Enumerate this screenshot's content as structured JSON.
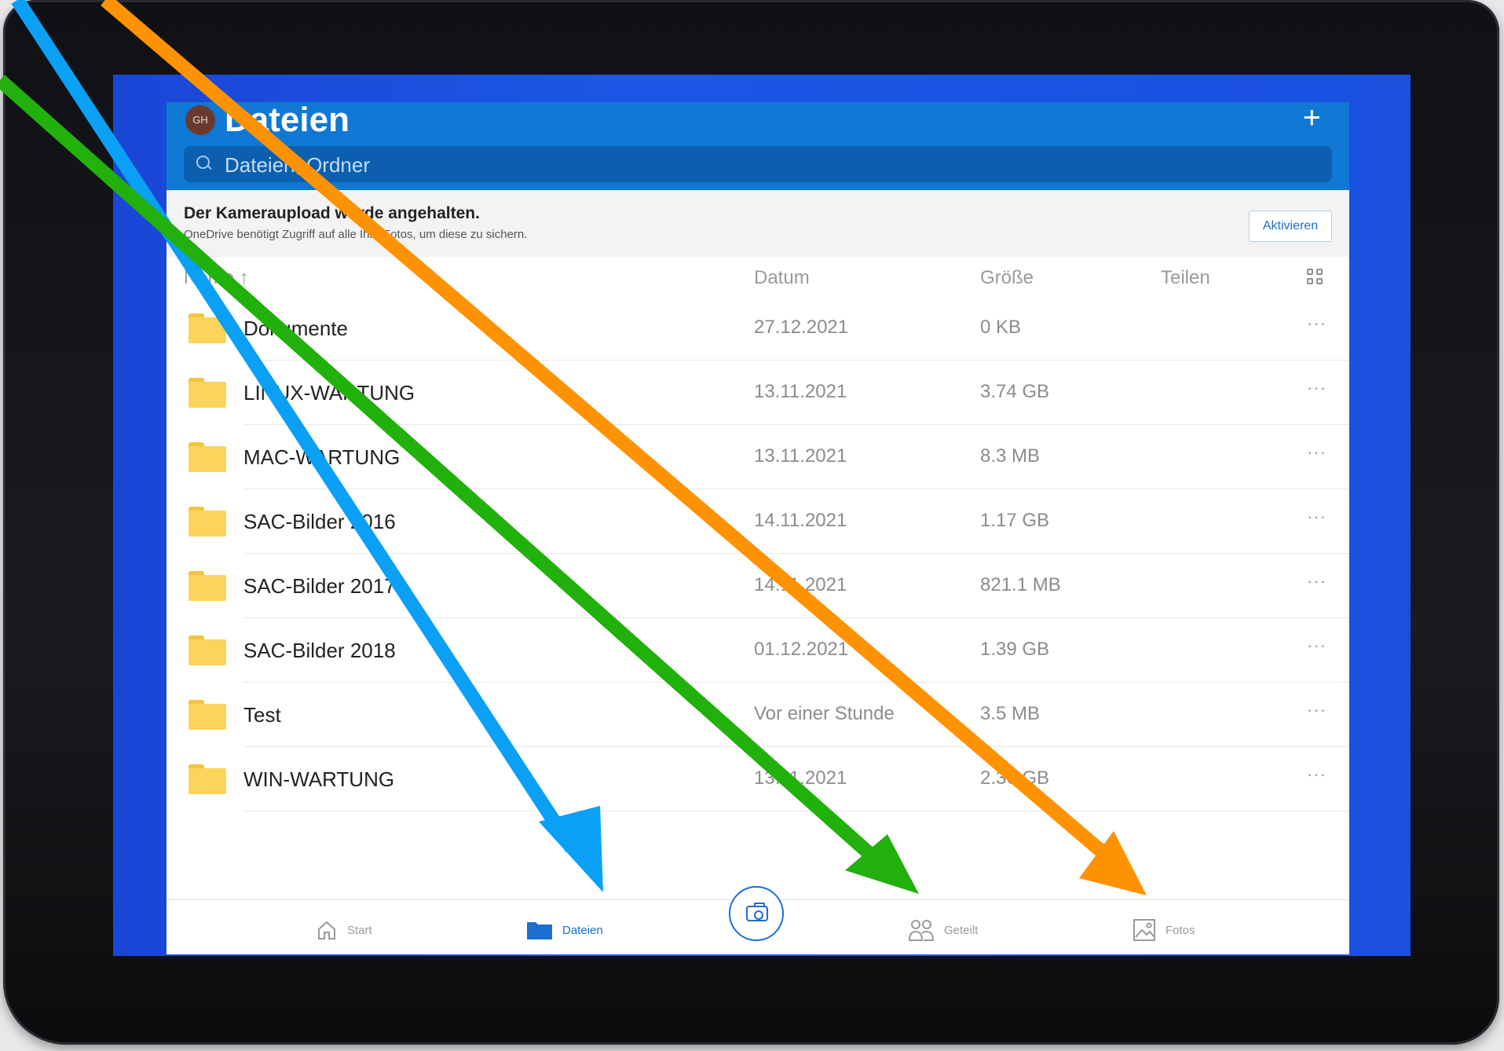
{
  "header": {
    "avatar_initials": "GH",
    "title": "Dateien",
    "add_label": "+",
    "search_placeholder": "Dateien, Ordner"
  },
  "banner": {
    "title": "Der Kameraupload wurde angehalten.",
    "text": "OneDrive benötigt Zugriff auf alle Ihre Fotos, um diese zu sichern.",
    "action_label": "Aktivieren"
  },
  "columns": {
    "name": "Name ↑",
    "date": "Datum",
    "size": "Größe",
    "share": "Teilen"
  },
  "files": [
    {
      "name": "Dokumente",
      "date": "27.12.2021",
      "size": "0 KB",
      "more": "···"
    },
    {
      "name": "LINUX-WARTUNG",
      "date": "13.11.2021",
      "size": "3.74 GB",
      "more": "···"
    },
    {
      "name": "MAC-WARTUNG",
      "date": "13.11.2021",
      "size": "8.3 MB",
      "more": "···"
    },
    {
      "name": "SAC-Bilder 2016",
      "date": "14.11.2021",
      "size": "1.17 GB",
      "more": "···"
    },
    {
      "name": "SAC-Bilder 2017",
      "date": "14.11.2021",
      "size": "821.1 MB",
      "more": "···"
    },
    {
      "name": "SAC-Bilder 2018",
      "date": "01.12.2021",
      "size": "1.39 GB",
      "more": "···"
    },
    {
      "name": "Test",
      "date": "Vor einer Stunde",
      "size": "3.5 MB",
      "more": "···"
    },
    {
      "name": "WIN-WARTUNG",
      "date": "13.11.2021",
      "size": "2.36 GB",
      "more": "···"
    }
  ],
  "nav": {
    "start": "Start",
    "files": "Dateien",
    "shared": "Geteilt",
    "photos": "Fotos"
  },
  "colors": {
    "accent": "#0f78d4",
    "arrow_blue": "#0aa0f5",
    "arrow_green": "#22b00c",
    "arrow_orange": "#ff9200"
  }
}
